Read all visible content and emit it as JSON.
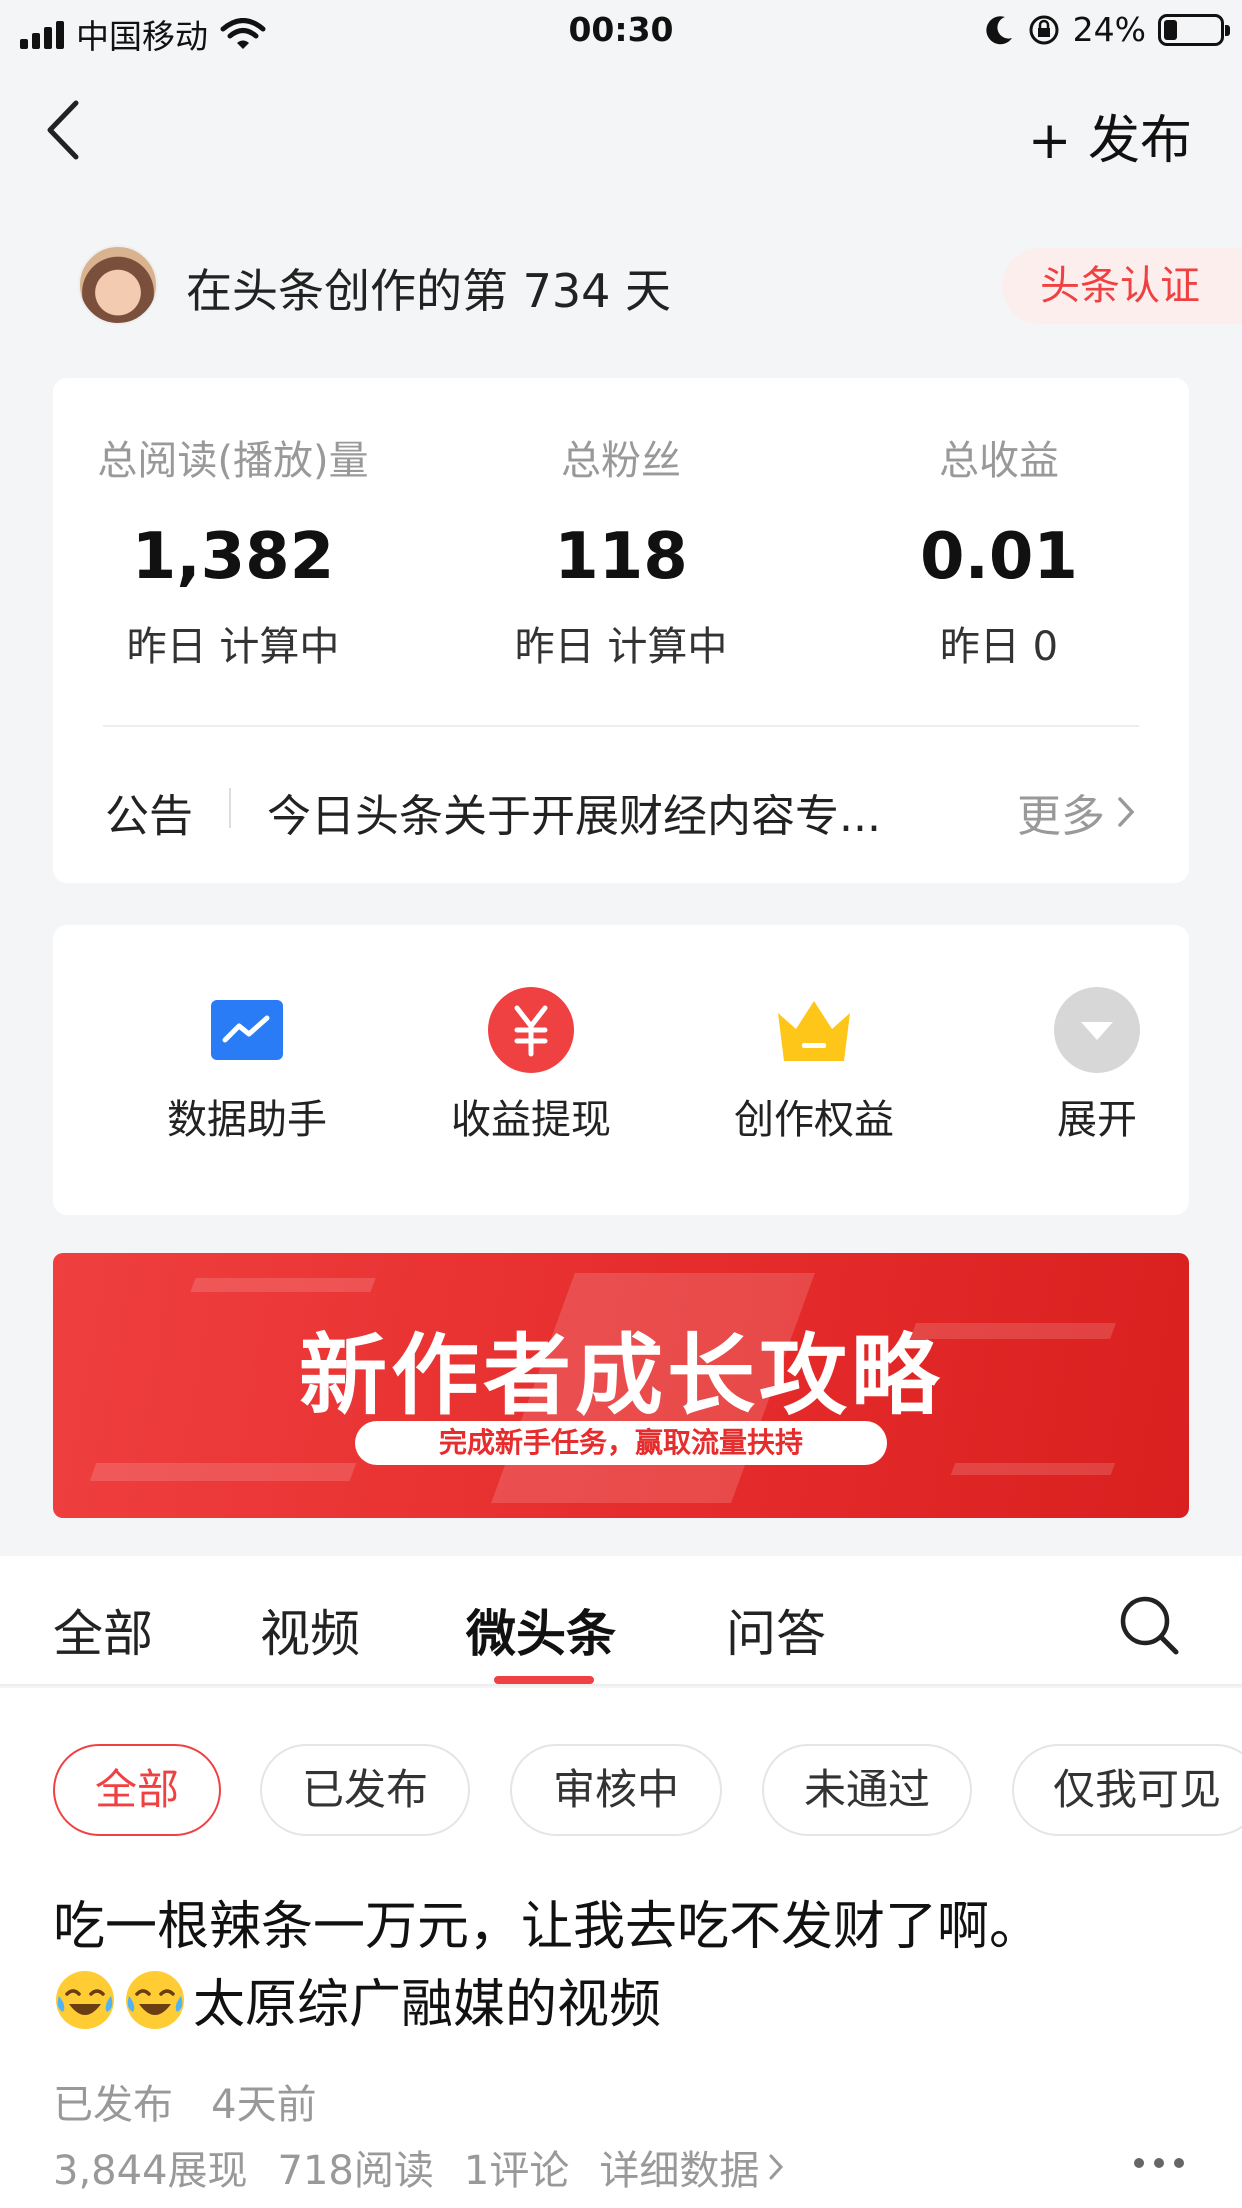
{
  "status_bar": {
    "carrier": "中国移动",
    "time": "00:30",
    "battery_text": "24%",
    "battery_level": 0.24
  },
  "nav": {
    "publish_label": "+ 发布"
  },
  "profile": {
    "days_text": "在头条创作的第 734 天",
    "verify_badge": "头条认证"
  },
  "stats": [
    {
      "label": "总阅读(播放)量",
      "value": "1,382",
      "sub": "昨日 计算中"
    },
    {
      "label": "总粉丝",
      "value": "118",
      "sub": "昨日 计算中"
    },
    {
      "label": "总收益",
      "value": "0.01",
      "sub": "昨日 0"
    }
  ],
  "notice": {
    "label": "公告",
    "text": "今日头条关于开展财经内容专...",
    "more": "更多"
  },
  "tools": [
    {
      "name": "数据助手",
      "icon": "chart-icon"
    },
    {
      "name": "收益提现",
      "icon": "yuan-icon"
    },
    {
      "name": "创作权益",
      "icon": "crown-icon"
    },
    {
      "name": "展开",
      "icon": "expand-icon"
    }
  ],
  "banner": {
    "title": "新作者成长攻略",
    "subtitle": "完成新手任务，赢取流量扶持"
  },
  "tabs": [
    "全部",
    "视频",
    "微头条",
    "问答"
  ],
  "active_tab": "微头条",
  "filters": [
    "全部",
    "已发布",
    "审核中",
    "未通过",
    "仅我可见"
  ],
  "active_filter": "全部",
  "post": {
    "title_line1": "吃一根辣条一万元，让我去吃不发财了啊。",
    "title_line2": "太原综广融媒的视频",
    "status": "已发布",
    "time": "4天前",
    "impressions": "3,844展现",
    "reads": "718阅读",
    "comments": "1评论",
    "detail": "详细数据"
  },
  "colors": {
    "accent": "#f04142",
    "background": "#f4f5f6"
  }
}
